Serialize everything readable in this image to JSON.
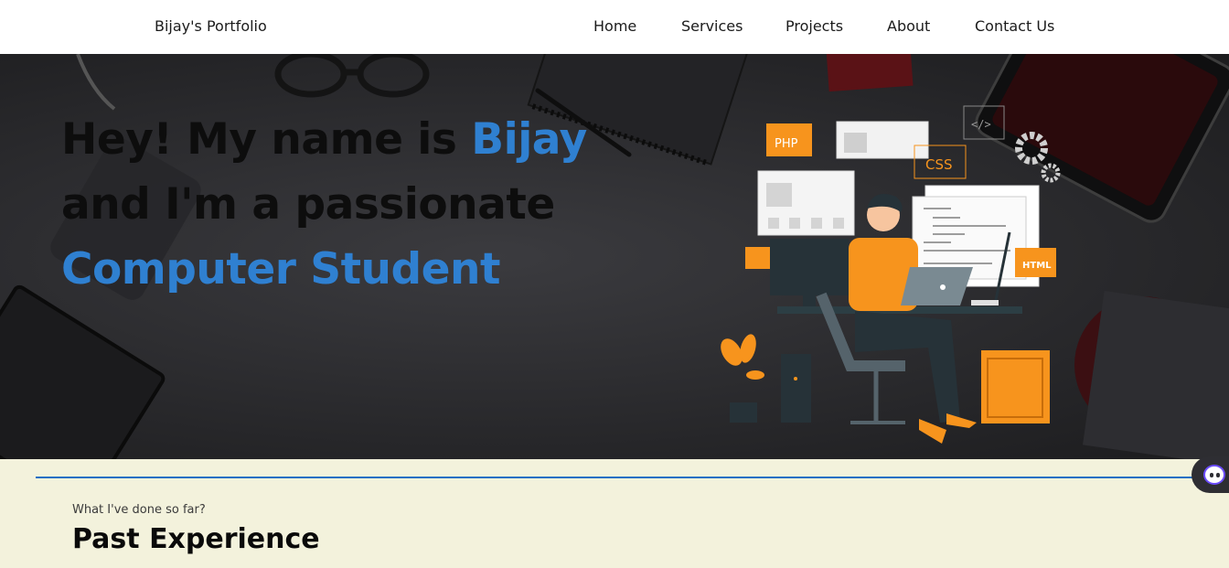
{
  "nav": {
    "brand": "Bijay's Portfolio",
    "links": [
      "Home",
      "Services",
      "Projects",
      "About",
      "Contact Us"
    ]
  },
  "hero": {
    "line1_prefix": "Hey! My name is ",
    "line1_name": "Bijay",
    "line2": "and I'm a passionate",
    "line3": "Computer Student",
    "illustration": {
      "tags": [
        "PHP",
        "CSS",
        "HTML"
      ]
    }
  },
  "experience": {
    "subtitle": "What I've done so far?",
    "title": "Past Experience"
  },
  "colors": {
    "accent": "#2f80d1",
    "orange": "#f7941d",
    "section_bg": "#f3f2dc",
    "divider": "#1a6fc4"
  }
}
